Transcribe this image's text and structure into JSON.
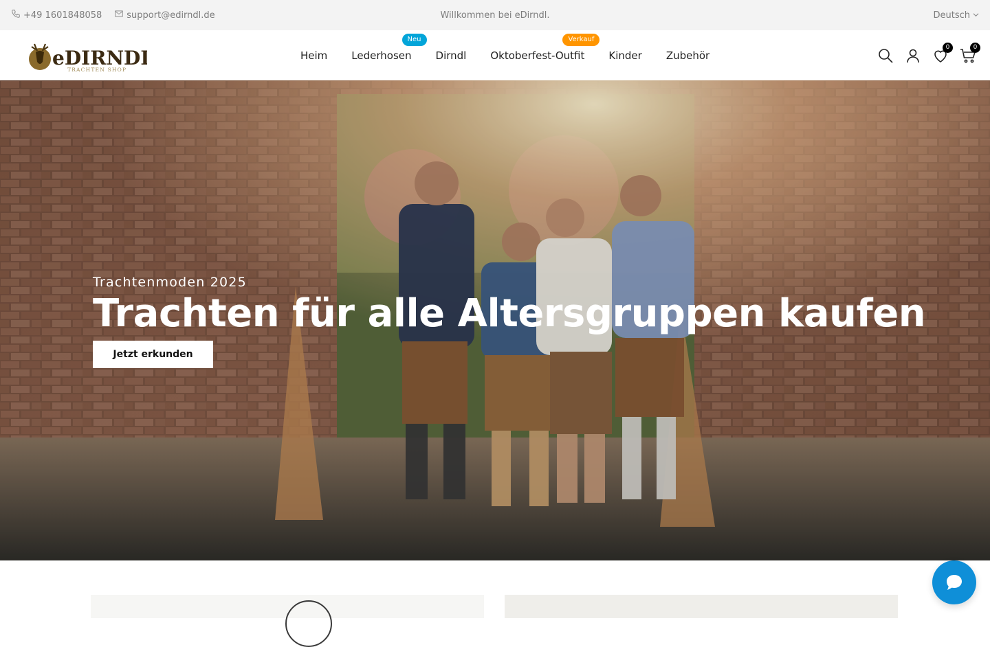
{
  "topbar": {
    "phone": "+49 1601848058",
    "email": "support@edirndl.de",
    "welcome": "Willkommen bei eDirndl.",
    "language": "Deutsch"
  },
  "header": {
    "logo_text": "eDIRNDL",
    "logo_tagline": "TRACHTEN SHOP",
    "nav": [
      {
        "label": "Heim"
      },
      {
        "label": "Lederhosen",
        "badge": "Neu"
      },
      {
        "label": "Dirndl"
      },
      {
        "label": "Oktoberfest-Outfit",
        "badge": "Verkauf"
      },
      {
        "label": "Kinder"
      },
      {
        "label": "Zubehör"
      }
    ],
    "wishlist_count": "0",
    "cart_count": "0",
    "icons": [
      "search-icon",
      "account-icon",
      "heart-icon",
      "cart-icon"
    ]
  },
  "hero": {
    "subtitle": "Trachtenmoden 2025",
    "title": "Trachten für alle Altersgruppen kaufen",
    "button": "Jetzt erkunden"
  },
  "colors": {
    "badge_new": "#03a5d9",
    "badge_sale": "#ff9500",
    "chat": "#0f8fd8",
    "topbar_bg": "#f3f3f3"
  }
}
